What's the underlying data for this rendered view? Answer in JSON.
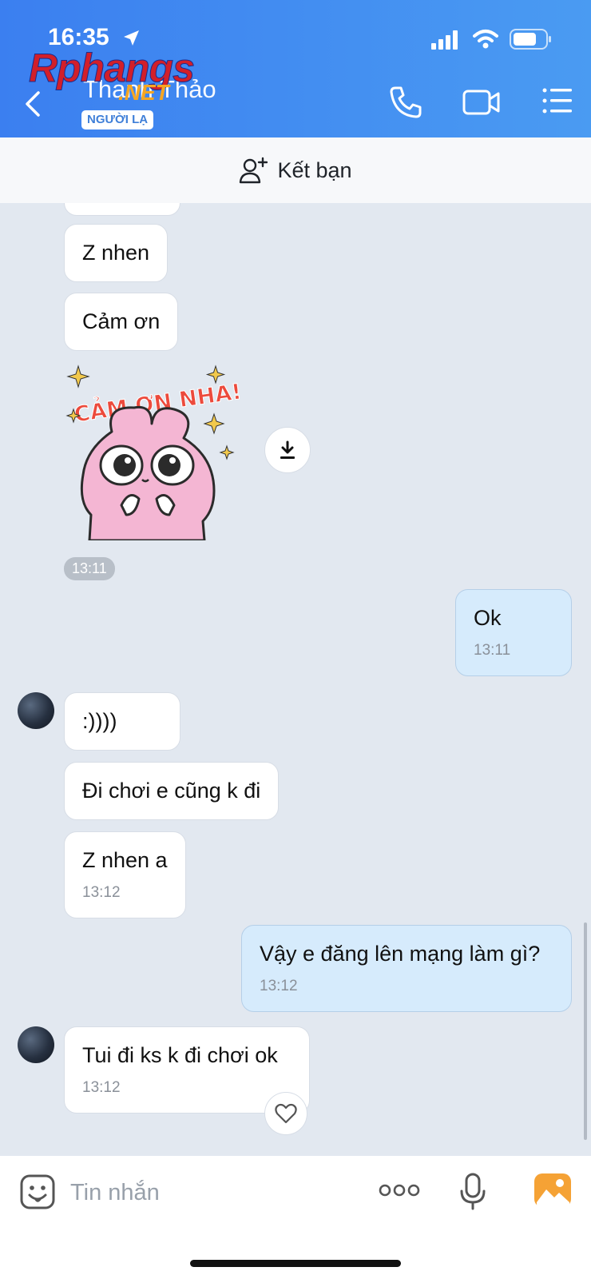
{
  "status": {
    "time": "16:35"
  },
  "watermark": {
    "main": "Rphangs",
    "suffix": ".NET"
  },
  "header": {
    "contact_name": "Thanh Thảo",
    "badge": "NGƯỜI LẠ"
  },
  "add_friend": {
    "label": "Kết bạn"
  },
  "sticker": {
    "text": "CẢM ƠN NHA!"
  },
  "messages": {
    "m1": {
      "text": "Z nhen"
    },
    "m2": {
      "text": "Cảm ơn"
    },
    "sticker_time": "13:11",
    "m3": {
      "text": "Ok",
      "time": "13:11"
    },
    "m4": {
      "text": ":))))"
    },
    "m5": {
      "text": "Đi chơi e cũng k đi"
    },
    "m6": {
      "text": "Z nhen a",
      "time": "13:12"
    },
    "m7": {
      "text": "Vậy e đăng lên mạng làm gì?",
      "time": "13:12"
    },
    "m8": {
      "text": "Tui đi ks k đi chơi ok",
      "time": "13:12"
    }
  },
  "input": {
    "placeholder": "Tin nhắn"
  },
  "colors": {
    "header_blue": "#3b7ff0",
    "sent_bubble": "#d6ebfc",
    "chat_bg": "#e2e8f0",
    "photo_orange": "#f5a235"
  },
  "icons": [
    "back-icon",
    "phone-icon",
    "video-icon",
    "menu-icon",
    "add-friend-icon",
    "download-icon",
    "heart-icon",
    "emoji-icon",
    "more-icon",
    "mic-icon",
    "photo-icon"
  ]
}
